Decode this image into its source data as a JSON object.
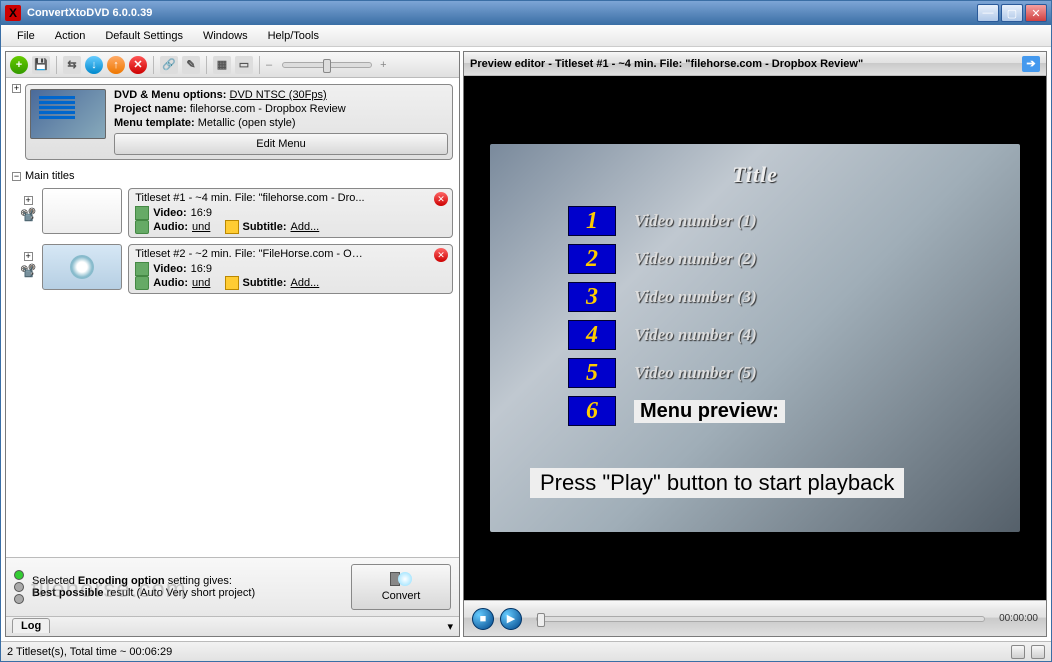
{
  "titlebar": {
    "title": "ConvertXtoDVD 6.0.0.39"
  },
  "menubar": [
    "File",
    "Action",
    "Default Settings",
    "Windows",
    "Help/Tools"
  ],
  "project": {
    "options_label": "DVD & Menu options:",
    "options_value": "DVD NTSC (30Fps)",
    "name_label": "Project name:",
    "name_value": "filehorse.com - Dropbox Review",
    "template_label": "Menu template:",
    "template_value": "Metallic (open style)",
    "edit_menu": "Edit Menu"
  },
  "tree": {
    "main_titles": "Main titles",
    "titlesets": [
      {
        "title": "Titleset #1 - ~4 min. File: \"filehorse.com - Dro...",
        "video_label": "Video:",
        "video_value": "16:9",
        "audio_label": "Audio:",
        "audio_value": "und",
        "subtitle_label": "Subtitle:",
        "subtitle_value": "Add..."
      },
      {
        "title": "Titleset #2 - ~2 min. File: \"FileHorse.com - Op...",
        "video_label": "Video:",
        "video_value": "16:9",
        "audio_label": "Audio:",
        "audio_value": "und",
        "subtitle_label": "Subtitle:",
        "subtitle_value": "Add..."
      }
    ]
  },
  "footer": {
    "line1a": "Selected ",
    "line1b": "Encoding option",
    "line1c": " setting gives:",
    "line2a": "Best possible",
    "line2b": " result (Auto Very short project)",
    "convert": "Convert"
  },
  "log_tab": "Log",
  "statusbar": "2 Titleset(s), Total time ~ 00:06:29",
  "preview": {
    "header": "Preview editor - Titleset #1 - ~4 min. File: \"filehorse.com - Dropbox Review\"",
    "title": "Title",
    "items": [
      {
        "num": "1",
        "label": "Video number (1)"
      },
      {
        "num": "2",
        "label": "Video number (2)"
      },
      {
        "num": "3",
        "label": "Video number (3)"
      },
      {
        "num": "4",
        "label": "Video number (4)"
      },
      {
        "num": "5",
        "label": "Video number (5)"
      },
      {
        "num": "6",
        "label": "Menu preview:"
      }
    ],
    "press_play": "Press \"Play\" button to start playback",
    "time": "00:00:00"
  }
}
